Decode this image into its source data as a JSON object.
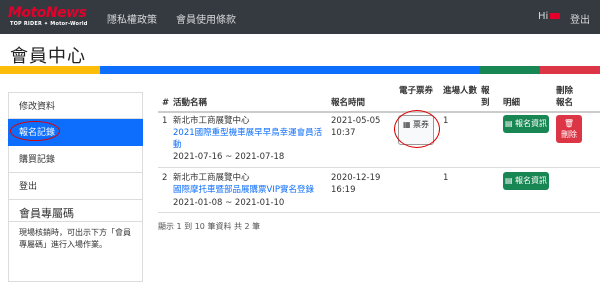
{
  "topbar": {
    "logo": {
      "brand": "MotoNews",
      "tag": "TOP RIDER ✦ Motor-World"
    },
    "nav": [
      "隱私權政策",
      "會員使用條款"
    ],
    "greeting": "Hi",
    "logout": "登出"
  },
  "page_title": "會員中心",
  "colors": {
    "band": [
      "#fbbd08",
      "#0d6efd",
      "#198754",
      "#dc3545"
    ],
    "active": "#0d6efd",
    "success": "#198754",
    "danger": "#dc3545"
  },
  "sidebar": {
    "items": [
      "修改資料",
      "報名記錄",
      "購買記錄",
      "登出"
    ],
    "active_index": 1,
    "heading": "會員專屬碼",
    "note": "現場核銷時，可出示下方「會員專屬碼」進行入場作業。"
  },
  "table": {
    "headers": [
      "#",
      "活動名稱",
      "報名時間",
      "電子票券",
      "進場人數",
      "報到",
      "明細",
      "刪除報名"
    ],
    "rows": [
      {
        "num": "1",
        "venue": "新北市工商展覽中心",
        "event": "2021國際重型機車展早早鳥幸運會員活動",
        "dates": "2021-07-16 ~ 2021-07-18",
        "reg_date": "2021-05-05",
        "reg_time": "10:37",
        "ticket_label": "票券",
        "people": "1",
        "detail_label": "報名資訊",
        "delete_label": "刪除"
      },
      {
        "num": "2",
        "venue": "新北市工商展覽中心",
        "event": "國際摩托車暨部品展購票VIP實名登錄",
        "dates": "2021-01-08 ~ 2021-01-10",
        "reg_date": "2020-12-19",
        "reg_time": "16:19",
        "people": "1",
        "detail_label": "報名資訊"
      }
    ],
    "footer": "顯示 1 到 10 筆資料 共 2 筆"
  },
  "icons": {
    "ticket": "qrcode-icon",
    "detail": "list-icon",
    "delete": "trash-icon"
  }
}
